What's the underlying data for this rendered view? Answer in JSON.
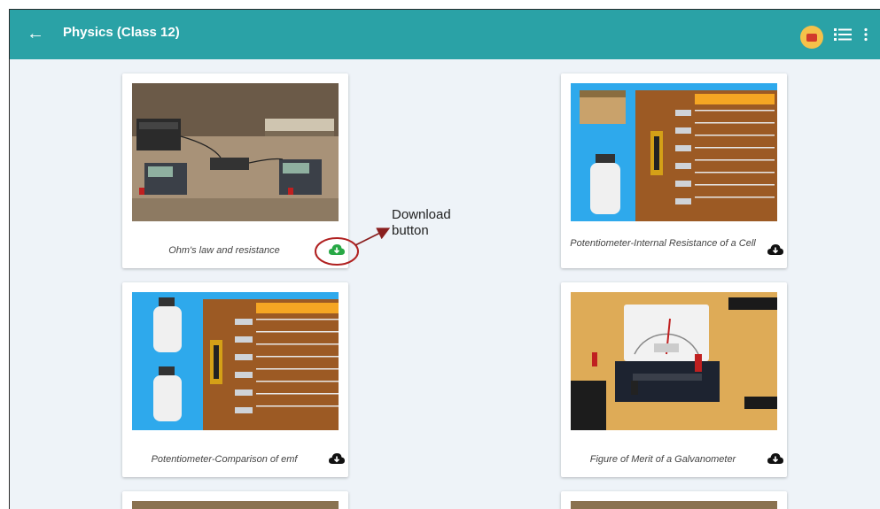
{
  "header": {
    "title": "Physics (Class 12)"
  },
  "cards": [
    {
      "caption": "Ohm's law and resistance"
    },
    {
      "caption": "Potentiometer-Internal Resistance of a Cell"
    },
    {
      "caption": "Potentiometer-Comparison of emf"
    },
    {
      "caption": "Figure of Merit of a Galvanometer"
    }
  ],
  "annotation": {
    "line1": "Download",
    "line2": "button"
  },
  "colors": {
    "appbar": "#2aa2a6",
    "download_active": "#27a845",
    "download_default": "#111111",
    "annotation_circle": "#b02020"
  },
  "icons": {
    "back": "arrow-left-icon",
    "avatar": "user-avatar-icon",
    "list": "list-view-icon",
    "more": "more-vert-icon",
    "download": "cloud-download-icon"
  }
}
